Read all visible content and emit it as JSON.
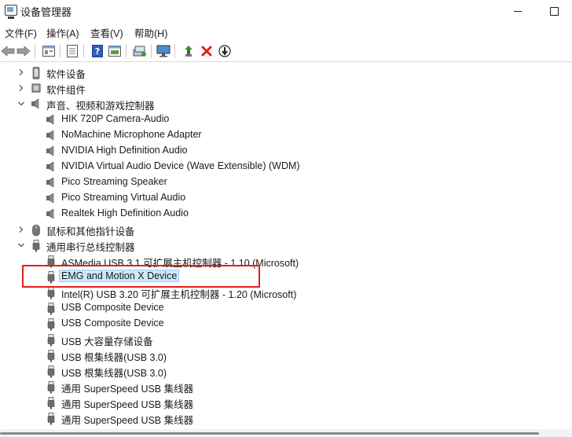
{
  "window": {
    "title": "设备管理器"
  },
  "menu": [
    "文件(F)",
    "操作(A)",
    "查看(V)",
    "帮助(H)"
  ],
  "toolbar": {
    "buttons": [
      "back-arrow-icon",
      "forward-arrow-icon",
      "properties-icon",
      "device-view-icon",
      "help-icon",
      "resources-icon",
      "scan-hardware-icon",
      "monitor-icon",
      "update-driver-icon",
      "uninstall-icon",
      "disable-icon"
    ]
  },
  "tree": [
    {
      "level": 1,
      "expand": "collapsed",
      "icon": "phone-icon",
      "label": "软件设备"
    },
    {
      "level": 1,
      "expand": "collapsed",
      "icon": "component-icon",
      "label": "软件组件"
    },
    {
      "level": 1,
      "expand": "expanded",
      "icon": "speaker-icon",
      "label": "声音、视频和游戏控制器"
    },
    {
      "level": 2,
      "icon": "speaker-icon",
      "label": "HIK 720P Camera-Audio"
    },
    {
      "level": 2,
      "icon": "speaker-icon",
      "label": "NoMachine Microphone Adapter"
    },
    {
      "level": 2,
      "icon": "speaker-icon",
      "label": "NVIDIA High Definition Audio"
    },
    {
      "level": 2,
      "icon": "speaker-icon",
      "label": "NVIDIA Virtual Audio Device (Wave Extensible) (WDM)"
    },
    {
      "level": 2,
      "icon": "speaker-icon",
      "label": "Pico Streaming Speaker"
    },
    {
      "level": 2,
      "icon": "speaker-icon",
      "label": "Pico Streaming Virtual Audio"
    },
    {
      "level": 2,
      "icon": "speaker-icon",
      "label": "Realtek High Definition Audio"
    },
    {
      "level": 1,
      "expand": "collapsed",
      "icon": "mouse-icon",
      "label": "鼠标和其他指针设备"
    },
    {
      "level": 1,
      "expand": "expanded",
      "icon": "usb-icon",
      "label": "通用串行总线控制器"
    },
    {
      "level": 2,
      "icon": "usb-icon",
      "label": "ASMedia USB 3.1 可扩展主机控制器 - 1.10 (Microsoft)"
    },
    {
      "level": 2,
      "icon": "usb-icon",
      "label": "EMG and Motion X Device",
      "selected": true
    },
    {
      "level": 2,
      "icon": "usb-icon",
      "label": "Intel(R) USB 3.20 可扩展主机控制器 - 1.20 (Microsoft)"
    },
    {
      "level": 2,
      "icon": "usb-icon",
      "label": "USB Composite Device"
    },
    {
      "level": 2,
      "icon": "usb-icon",
      "label": "USB Composite Device"
    },
    {
      "level": 2,
      "icon": "usb-icon",
      "label": "USB 大容量存储设备"
    },
    {
      "level": 2,
      "icon": "usb-icon",
      "label": "USB 根集线器(USB 3.0)"
    },
    {
      "level": 2,
      "icon": "usb-icon",
      "label": "USB 根集线器(USB 3.0)"
    },
    {
      "level": 2,
      "icon": "usb-icon",
      "label": "通用 SuperSpeed USB 集线器"
    },
    {
      "level": 2,
      "icon": "usb-icon",
      "label": "通用 SuperSpeed USB 集线器"
    },
    {
      "level": 2,
      "icon": "usb-icon",
      "label": "通用 SuperSpeed USB 集线器"
    }
  ],
  "colors": {
    "highlight": "#e0201b",
    "selection": "#cce8ff"
  }
}
